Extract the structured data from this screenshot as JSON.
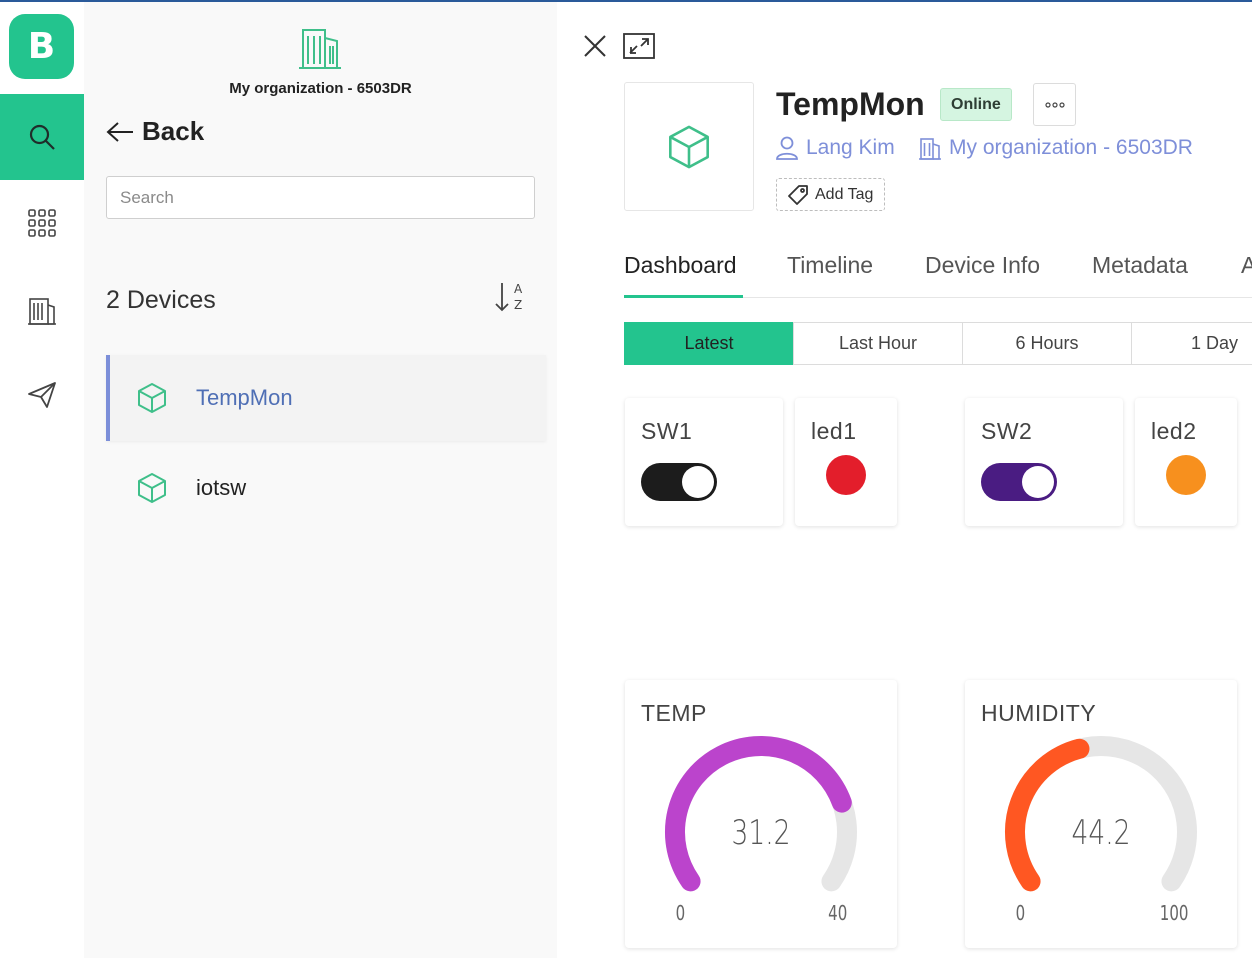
{
  "app": {
    "logo_letter": "B",
    "accent_color": "#23c48e"
  },
  "rail": {
    "items": [
      {
        "icon": "search-icon",
        "active": true
      },
      {
        "icon": "grid-icon",
        "active": false
      },
      {
        "icon": "building-icon",
        "active": false
      },
      {
        "icon": "send-icon",
        "active": false
      }
    ]
  },
  "panel": {
    "org_name": "My organization - 6503DR",
    "back_label": "Back",
    "search_placeholder": "Search",
    "device_count": "2 Devices",
    "sort_icon": "sort-az-icon",
    "devices": [
      {
        "name": "TempMon",
        "active": true
      },
      {
        "name": "iotsw",
        "active": false
      }
    ]
  },
  "device": {
    "name": "TempMon",
    "status": "Online",
    "owner": "Lang Kim",
    "organization": "My organization - 6503DR",
    "add_tag_label": "Add Tag"
  },
  "tabs": [
    "Dashboard",
    "Timeline",
    "Device Info",
    "Metadata",
    "A"
  ],
  "active_tab": "Dashboard",
  "ranges": [
    "Latest",
    "Last Hour",
    "6 Hours",
    "1 Day"
  ],
  "active_range": "Latest",
  "widgets": {
    "sw1": {
      "title": "SW1",
      "state": "on",
      "color": "#1c1c1c"
    },
    "led1": {
      "title": "led1",
      "color": "#e31e2b"
    },
    "sw2": {
      "title": "SW2",
      "state": "on",
      "color": "#4a1c82"
    },
    "led2": {
      "title": "led2",
      "color": "#f7901e"
    },
    "temp": {
      "title": "TEMP",
      "value": "31.2",
      "min": "0",
      "max": "40",
      "fraction": 0.78,
      "color": "#bb44cc"
    },
    "humidity": {
      "title": "HUMIDITY",
      "value": "44.2",
      "min": "0",
      "max": "100",
      "fraction": 0.442,
      "color": "#ff5722"
    }
  }
}
